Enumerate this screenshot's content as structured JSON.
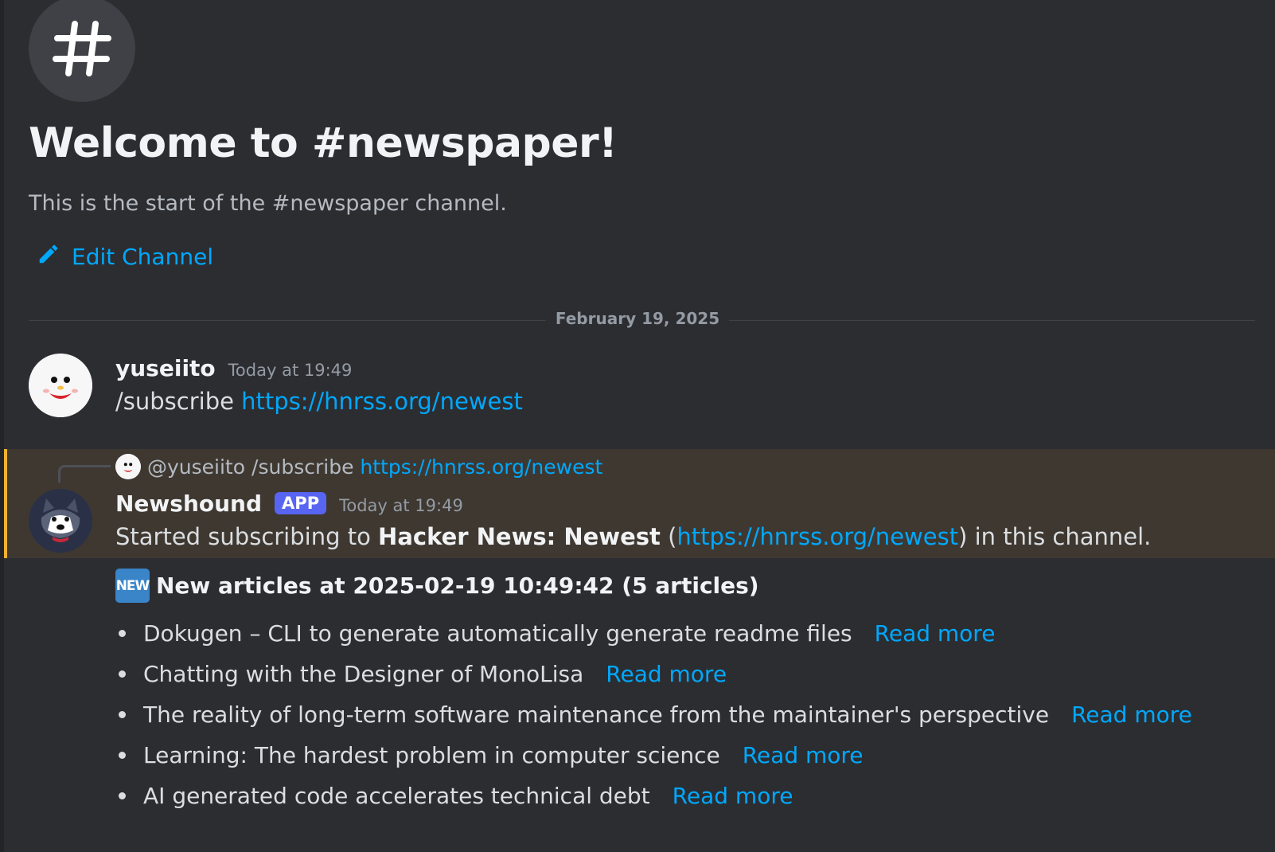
{
  "channel": {
    "hash_icon": "hash-icon",
    "welcome_title": "Welcome to #newspaper!",
    "welcome_subtitle": "This is the start of the #newspaper channel.",
    "edit_label": "Edit Channel",
    "edit_icon": "pencil-icon"
  },
  "date_divider": "February 19, 2025",
  "messages": [
    {
      "username": "yuseiito",
      "timestamp": "Today at 19:49",
      "text_prefix": "/subscribe ",
      "link": "https://hnrss.org/newest"
    },
    {
      "reply": {
        "user": "@yuseiito",
        "text": "/subscribe ",
        "link": "https://hnrss.org/newest"
      },
      "username": "Newshound",
      "app_tag": "APP",
      "timestamp": "Today at 19:49",
      "text_prefix": "Started subscribing to ",
      "bold": "Hacker News: Newest",
      "open_paren": " (",
      "link": "https://hnrss.org/newest",
      "text_suffix": ") in this channel."
    }
  ],
  "articles": {
    "badge": "NEW",
    "title": "New articles at 2025-02-19 10:49:42 (5 articles)",
    "items": [
      {
        "title": "Dokugen – CLI to generate automatically generate readme files",
        "link": "Read more"
      },
      {
        "title": "Chatting with the Designer of MonoLisa",
        "link": "Read more"
      },
      {
        "title": "The reality of long-term software maintenance from the maintainer's perspective",
        "link": "Read more"
      },
      {
        "title": "Learning: The hardest problem in computer science",
        "link": "Read more"
      },
      {
        "title": "AI generated code accelerates technical debt",
        "link": "Read more"
      }
    ]
  },
  "colors": {
    "background": "#2c2d31",
    "link": "#00a8fc",
    "highlight": "#3e3831",
    "highlight_bar": "#f0b232",
    "app_tag": "#5865f2"
  }
}
